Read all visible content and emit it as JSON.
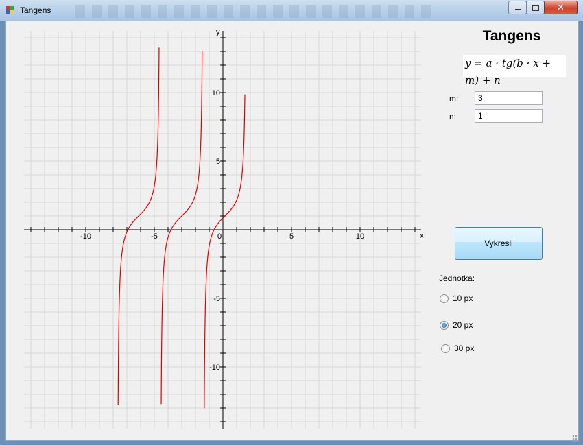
{
  "window": {
    "title": "Tangens",
    "icons": [
      "app-icon",
      "minimize-icon",
      "maximize-icon",
      "close-icon"
    ]
  },
  "panel": {
    "heading": "Tangens",
    "formula": "y = a · tg(b · x + m) + n",
    "m_label": "m:",
    "m_value": "3",
    "n_label": "n:",
    "n_value": "1",
    "draw_button": "Vykresli",
    "unit_label": "Jednotka:",
    "units": [
      "10 px",
      "20 px",
      "30 px"
    ],
    "selected_unit": "20 px"
  },
  "chart_data": {
    "type": "line",
    "function": "y = tan(x + 3) + 1",
    "xlabel": "x",
    "ylabel": "y",
    "xlim": [
      -14.5,
      14.5
    ],
    "ylim": [
      -14.5,
      14.5
    ],
    "x_tick_labels": [
      "-10",
      "-5",
      "0",
      "5",
      "10"
    ],
    "y_tick_labels": [
      "10",
      "5",
      "-5",
      "-10"
    ],
    "grid": true,
    "line_color": "#dd0000",
    "visible_x_range": [
      -7.7,
      1.6
    ]
  },
  "colors": {
    "background": "#f0f0f0",
    "grid": "#d8d8d8",
    "axis": "#000000",
    "curve": "#dd0000"
  }
}
